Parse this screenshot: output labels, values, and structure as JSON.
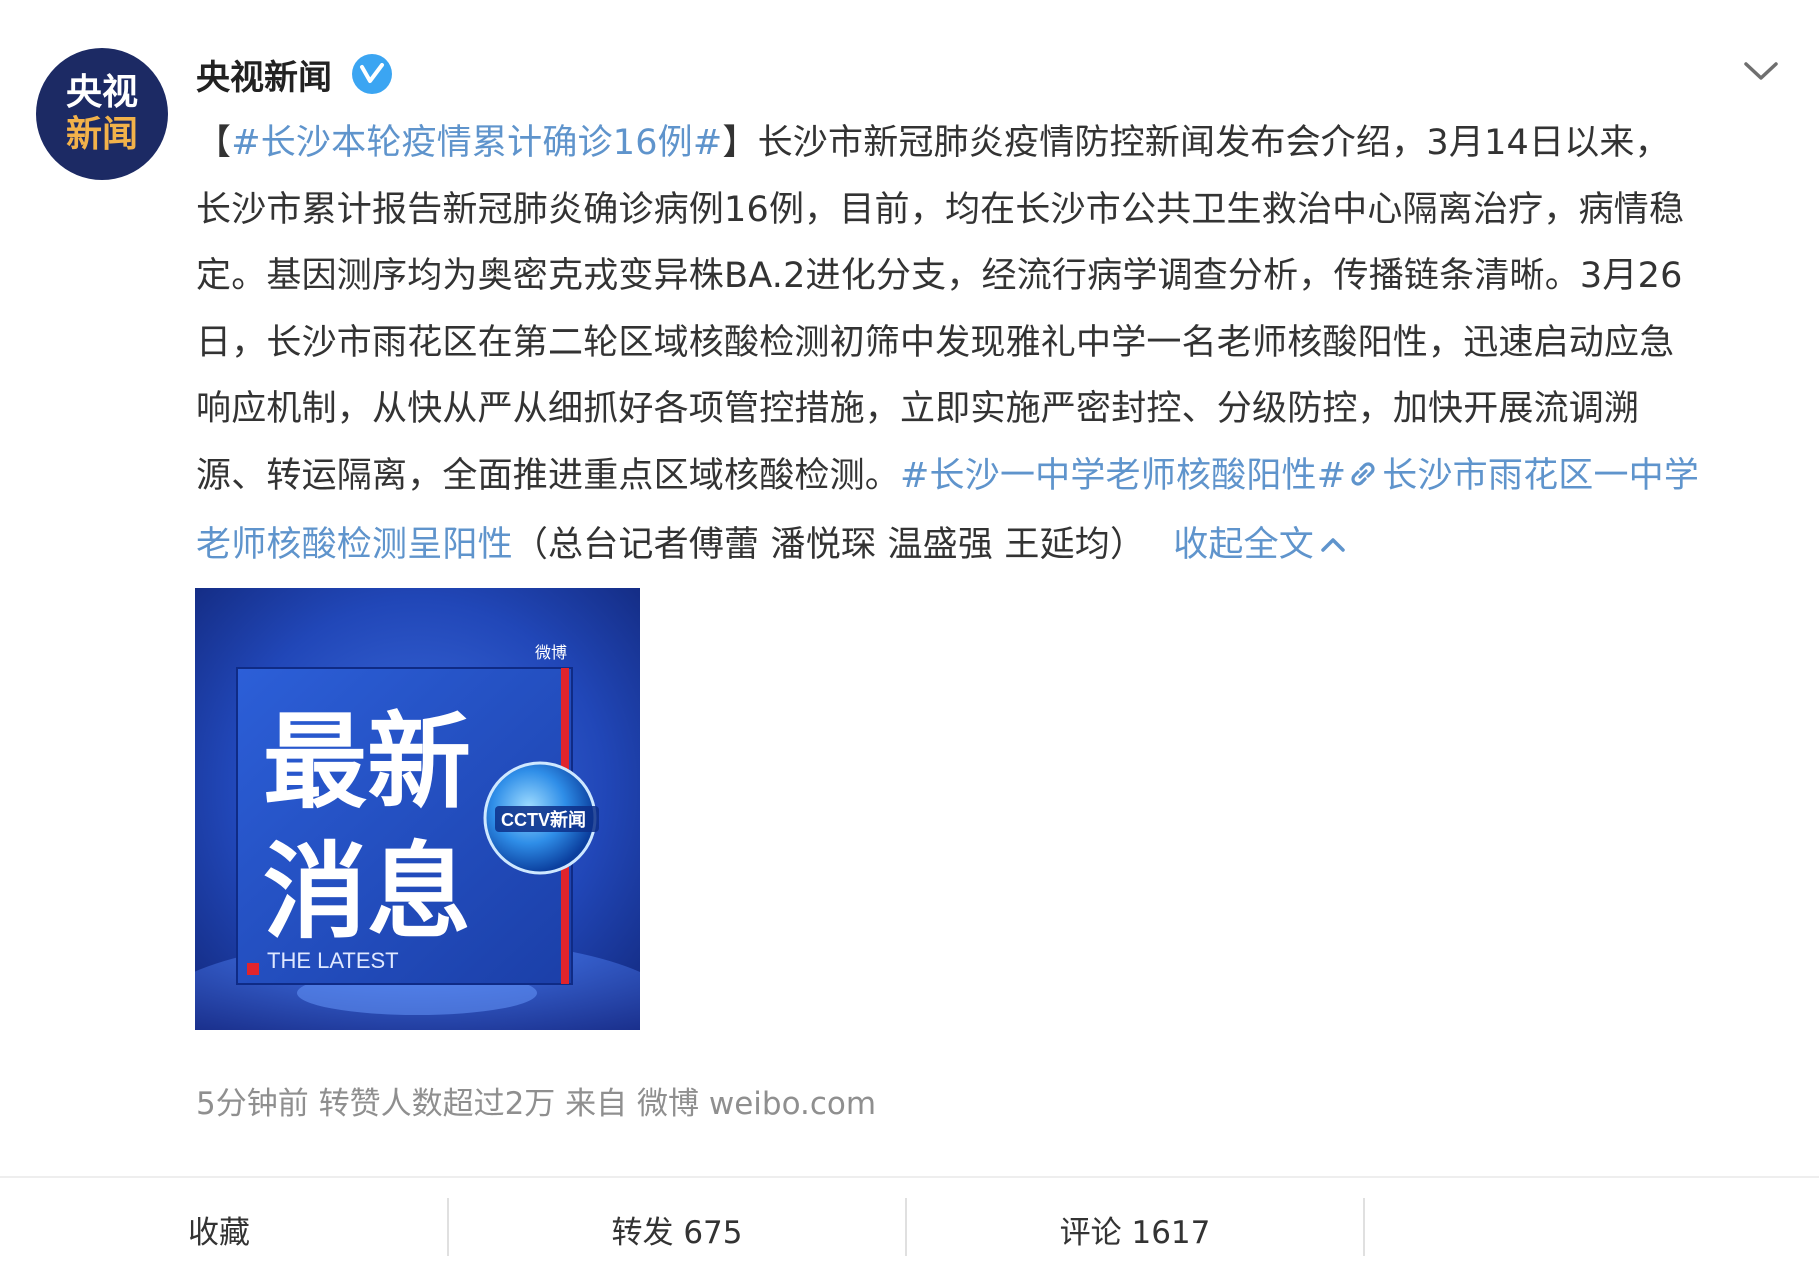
{
  "account": {
    "avatar_line1": "央视",
    "avatar_line2": "新闻",
    "name": "央视新闻",
    "verified_icon": "verified-badge-icon"
  },
  "post": {
    "lines": [
      [
        {
          "text": "【",
          "link": false
        },
        {
          "text": "#长沙本轮疫情累计确诊16例#",
          "link": true
        },
        {
          "text": "】长沙市新冠肺炎疫情防控新闻发布会介绍，3月14日以来，",
          "link": false
        }
      ],
      [
        {
          "text": "长沙市累计报告新冠肺炎确诊病例16例，目前，均在长沙市公共卫生救治中心隔离治疗，病情稳",
          "link": false
        }
      ],
      [
        {
          "text": "定。基因测序均为奥密克戎变异株BA.2进化分支，经流行病学调查分析，传播链条清晰。3月26",
          "link": false
        }
      ],
      [
        {
          "text": "日，长沙市雨花区在第二轮区域核酸检测初筛中发现雅礼中学一名老师核酸阳性，迅速启动应急",
          "link": false
        }
      ],
      [
        {
          "text": "响应机制，从快从严从细抓好各项管控措施，立即实施严密封控、分级防控，加快开展流调溯",
          "link": false
        }
      ],
      [
        {
          "text": "源、转运隔离，全面推进重点区域核酸检测。",
          "link": false
        },
        {
          "text": "#长沙一中学老师核酸阳性#",
          "link": true
        },
        {
          "text": "长沙市雨花区一中学",
          "link": true,
          "icon": "link-icon"
        }
      ],
      [
        {
          "text": "老师核酸检测呈阳性",
          "link": true
        },
        {
          "text": "（总台记者傅蕾 潘悦琛 温盛强 王延均）",
          "link": false
        },
        {
          "text": "收起全文",
          "link": true,
          "icon": "chevron-up-icon"
        }
      ]
    ],
    "image": {
      "title_line1": "最新",
      "title_line2": "消息",
      "subtitle": "THE LATEST",
      "logo_text": "CCTV新闻",
      "watermark": "微博"
    },
    "meta": "5分钟前  转赞人数超过2万    来自 微博 weibo.com"
  },
  "actions": {
    "favorite": "收藏",
    "forward": "转发 675",
    "comment": "评论 1617"
  },
  "colors": {
    "link": "#5f94cc",
    "text": "#333333",
    "meta": "#8f8f8f",
    "verified": "#3ba5f2",
    "avatar_bg": "#1c2a64"
  }
}
